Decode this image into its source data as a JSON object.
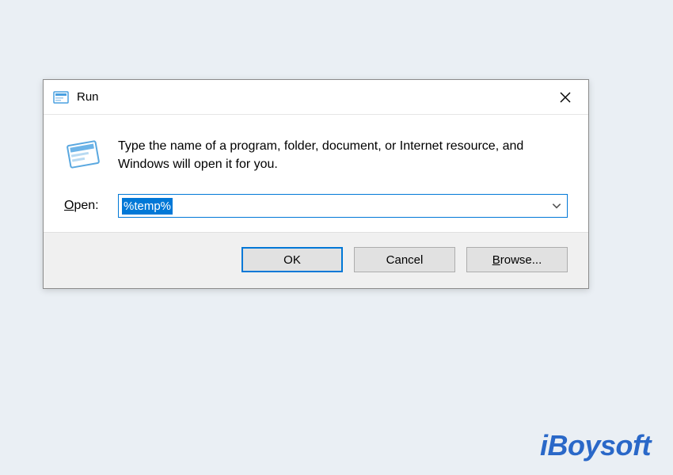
{
  "dialog": {
    "title": "Run",
    "description": "Type the name of a program, folder, document, or Internet resource, and Windows will open it for you.",
    "open_label_prefix": "O",
    "open_label_rest": "pen:",
    "input_value": "%temp%",
    "buttons": {
      "ok": "OK",
      "cancel": "Cancel",
      "browse_prefix": "B",
      "browse_rest": "rowse..."
    }
  },
  "watermark": "iBoysoft",
  "colors": {
    "accent": "#0078d7",
    "page_bg": "#eaeff4",
    "btn_bg": "#e1e1e1"
  }
}
